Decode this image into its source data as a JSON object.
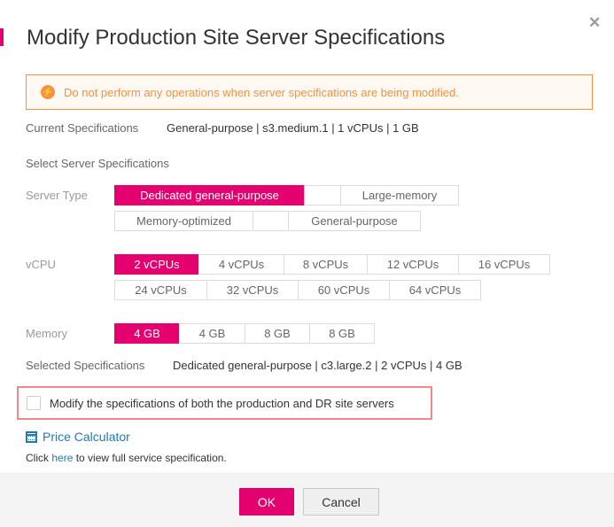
{
  "dialog": {
    "title": "Modify Production Site Server Specifications",
    "close_icon": "close-icon"
  },
  "alert": {
    "icon": "lightning-icon",
    "text": "Do not perform any operations when server specifications are being modified."
  },
  "current_specs": {
    "label": "Current Specifications",
    "value": "General-purpose | s3.medium.1 | 1 vCPUs | 1 GB"
  },
  "select_heading": "Select Server Specifications",
  "server_type": {
    "label": "Server Type",
    "options": [
      {
        "label": "Dedicated general-purpose",
        "selected": true
      },
      {
        "label": "",
        "selected": false
      },
      {
        "label": "Large-memory",
        "selected": false
      },
      {
        "label": "Memory-optimized",
        "selected": false
      },
      {
        "label": "",
        "selected": false
      },
      {
        "label": "General-purpose",
        "selected": false
      }
    ]
  },
  "vcpu": {
    "label": "vCPU",
    "options": [
      {
        "label": "2 vCPUs",
        "selected": true
      },
      {
        "label": "4 vCPUs",
        "selected": false
      },
      {
        "label": "8 vCPUs",
        "selected": false
      },
      {
        "label": "12 vCPUs",
        "selected": false
      },
      {
        "label": "16 vCPUs",
        "selected": false
      },
      {
        "label": "24 vCPUs",
        "selected": false
      },
      {
        "label": "32 vCPUs",
        "selected": false
      },
      {
        "label": "60 vCPUs",
        "selected": false
      },
      {
        "label": "64 vCPUs",
        "selected": false
      }
    ]
  },
  "memory": {
    "label": "Memory",
    "options": [
      {
        "label": "4 GB",
        "selected": true
      },
      {
        "label": "4 GB",
        "selected": false
      },
      {
        "label": "8 GB",
        "selected": false
      },
      {
        "label": "8 GB",
        "selected": false
      }
    ]
  },
  "selected_specs": {
    "label": "Selected Specifications",
    "value": "Dedicated general-purpose | c3.large.2 | 2 vCPUs | 4 GB"
  },
  "both_sites_checkbox": {
    "label": "Modify the specifications of both the production and DR site servers",
    "checked": false
  },
  "price_calculator": {
    "icon": "calculator-icon",
    "label": "Price Calculator"
  },
  "hint": {
    "prefix": "Click ",
    "link": "here",
    "suffix": " to view full service specification."
  },
  "footer": {
    "ok_label": "OK",
    "cancel_label": "Cancel"
  },
  "colors": {
    "accent": "#e4006f",
    "warning": "#f39440",
    "link": "#1f7ab7",
    "highlight_border": "#f08a8a"
  }
}
